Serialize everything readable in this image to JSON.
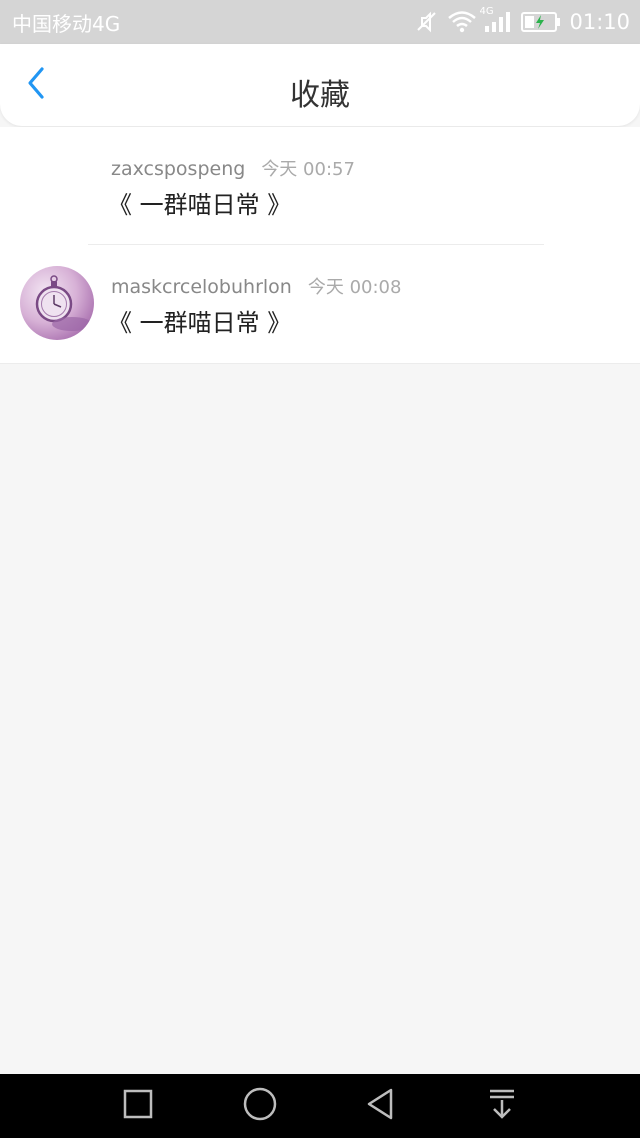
{
  "status_bar": {
    "carrier": "中国移动4G",
    "network_badge": "4G",
    "time": "01:10",
    "icons": [
      "mute-icon",
      "wifi-icon",
      "signal-icon",
      "battery-charging-icon"
    ]
  },
  "header": {
    "title": "收藏",
    "back_icon": "chevron-left-icon"
  },
  "favorites": [
    {
      "username": "zaxcspospeng",
      "time": "今天 00:57",
      "title": "《 一群喵日常 》",
      "has_avatar": false
    },
    {
      "username": "maskcrcelobuhrlon",
      "time": "今天 00:08",
      "title": "《 一群喵日常 》",
      "has_avatar": true
    }
  ],
  "system_nav": {
    "icons": [
      "recent-apps-icon",
      "home-icon",
      "back-icon",
      "notification-pulldown-icon"
    ]
  },
  "colors": {
    "accent": "#2196f3",
    "status_bar_bg": "#d5d5d5",
    "page_bg": "#f6f6f6"
  }
}
